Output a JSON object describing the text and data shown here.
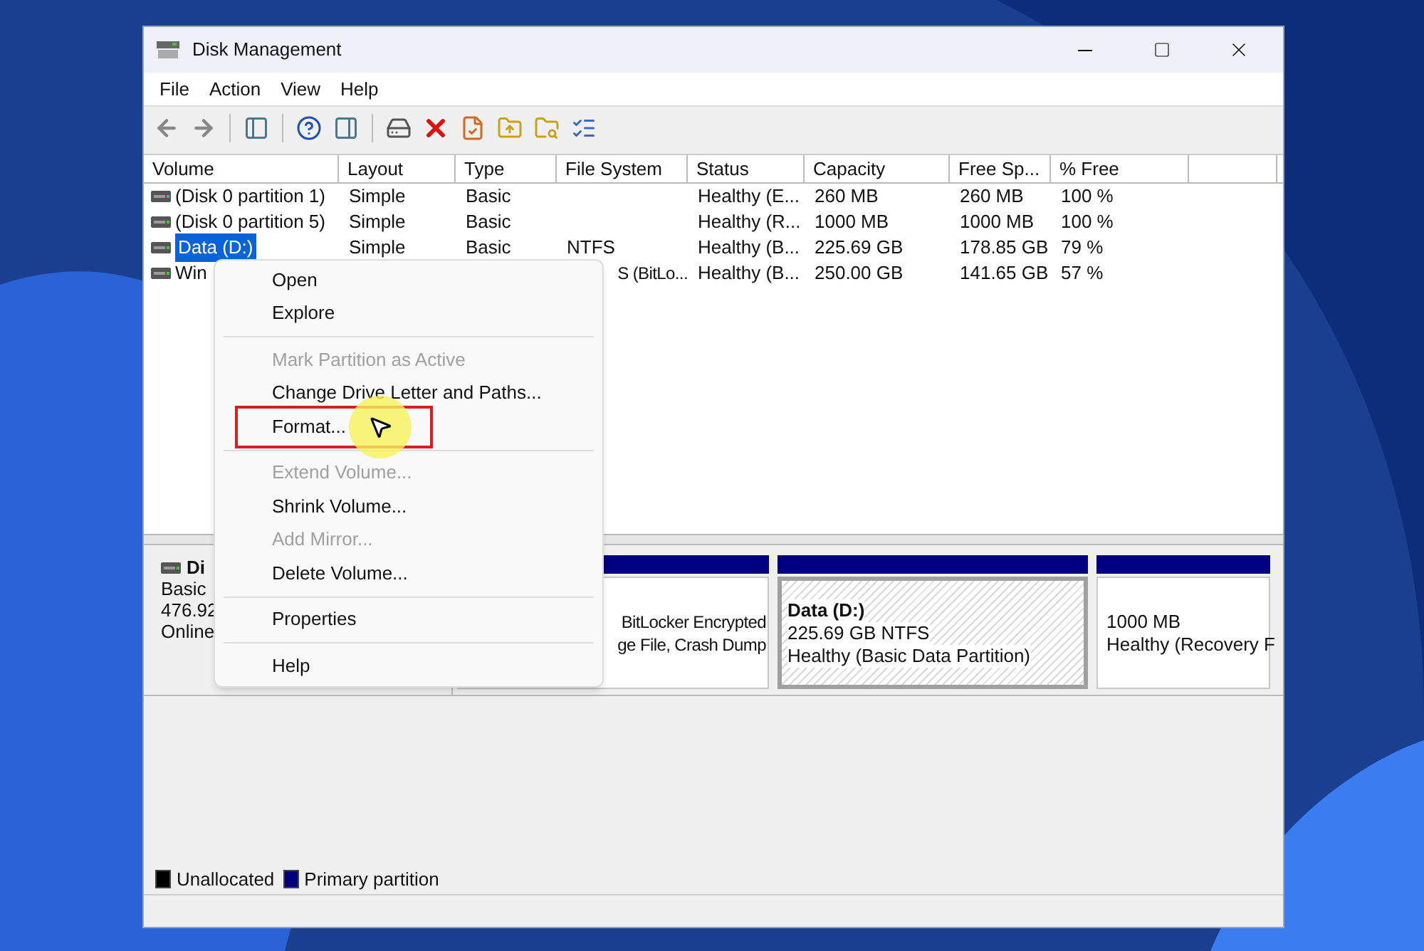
{
  "window": {
    "title": "Disk Management"
  },
  "menu_bar": [
    "File",
    "Action",
    "View",
    "Help"
  ],
  "table": {
    "columns": [
      "Volume",
      "Layout",
      "Type",
      "File System",
      "Status",
      "Capacity",
      "Free Sp...",
      "% Free"
    ],
    "rows": [
      {
        "selected": false,
        "cells": [
          "(Disk 0 partition 1)",
          "Simple",
          "Basic",
          "",
          "Healthy (E...",
          "260 MB",
          "260 MB",
          "100 %"
        ]
      },
      {
        "selected": false,
        "cells": [
          "(Disk 0 partition 5)",
          "Simple",
          "Basic",
          "",
          "Healthy (R...",
          "1000 MB",
          "1000 MB",
          "100 %"
        ]
      },
      {
        "selected": true,
        "cells": [
          "Data (D:)",
          "Simple",
          "Basic",
          "NTFS",
          "Healthy (B...",
          "225.69 GB",
          "178.85 GB",
          "79 %"
        ]
      },
      {
        "selected": false,
        "cells": [
          "Win",
          "",
          "",
          "S (BitLo...",
          "Healthy (B...",
          "250.00 GB",
          "141.65 GB",
          "57 %"
        ]
      }
    ]
  },
  "context_menu": [
    {
      "kind": "item",
      "label": "Open",
      "disabled": false
    },
    {
      "kind": "item",
      "label": "Explore",
      "disabled": false
    },
    {
      "kind": "separator"
    },
    {
      "kind": "item",
      "label": "Mark Partition as Active",
      "disabled": true
    },
    {
      "kind": "item",
      "label": "Change Drive Letter and Paths...",
      "disabled": false
    },
    {
      "kind": "item",
      "label": "Format...",
      "disabled": false,
      "annotated": true
    },
    {
      "kind": "separator"
    },
    {
      "kind": "item",
      "label": "Extend Volume...",
      "disabled": true
    },
    {
      "kind": "item",
      "label": "Shrink Volume...",
      "disabled": false
    },
    {
      "kind": "item",
      "label": "Add Mirror...",
      "disabled": true
    },
    {
      "kind": "item",
      "label": "Delete Volume...",
      "disabled": false
    },
    {
      "kind": "separator"
    },
    {
      "kind": "item",
      "label": "Properties",
      "disabled": false
    },
    {
      "kind": "separator"
    },
    {
      "kind": "item",
      "label": "Help",
      "disabled": false
    }
  ],
  "disk": {
    "name": "Di",
    "lines": [
      "Basic",
      "476.92",
      "Online"
    ],
    "partitions": [
      {
        "selected": false,
        "lines": [
          "BitLocker Encrypted",
          "ge File, Crash Dump"
        ]
      },
      {
        "selected": true,
        "title": "Data  (D:)",
        "lines": [
          "225.69 GB NTFS",
          "Healthy (Basic Data Partition)"
        ]
      },
      {
        "selected": false,
        "lines": [
          "1000 MB",
          "Healthy (Recovery F"
        ]
      }
    ]
  },
  "legend": [
    {
      "label": "Unallocated",
      "color": "#000000"
    },
    {
      "label": "Primary partition",
      "color": "#000080"
    }
  ]
}
